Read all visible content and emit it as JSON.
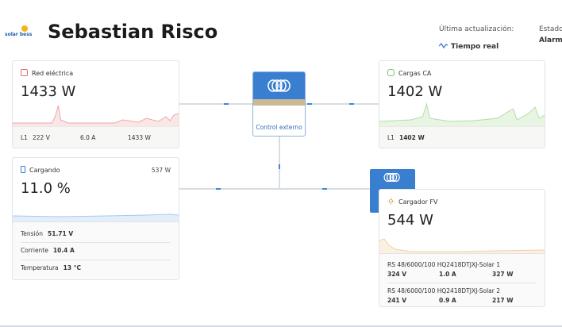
{
  "header": {
    "logo_text": "solar bess",
    "title": "Sebastian Risco",
    "update_label": "Última actualización:",
    "update_value": "Tiempo real",
    "status_label": "Estado:",
    "status_value": "Alarma"
  },
  "grid": {
    "title": "Red eléctrica",
    "power": "1433 W",
    "phase": "L1",
    "voltage": "222 V",
    "current": "6.0 A",
    "phase_power": "1433 W"
  },
  "battery": {
    "title": "Cargando",
    "power": "537 W",
    "soc": "11.0 %",
    "rows": [
      {
        "label": "Tensión",
        "value": "51.71 V"
      },
      {
        "label": "Corriente",
        "value": "10.4 A"
      },
      {
        "label": "Temperatura",
        "value": "13 °C"
      }
    ]
  },
  "control": {
    "label": "Control externo"
  },
  "ac_loads": {
    "title": "Cargas CA",
    "power": "1402 W",
    "phase": "L1",
    "phase_power": "1402 W"
  },
  "pv": {
    "title": "Cargador FV",
    "power": "544 W",
    "chargers": [
      {
        "name": "RS 48/6000/100 HQ2418DTJXJ-Solar 1",
        "voltage": "324 V",
        "current": "1.0 A",
        "power": "327 W"
      },
      {
        "name": "RS 48/6000/100 HQ2418DTJXJ-Solar 2",
        "voltage": "241 V",
        "current": "0.9 A",
        "power": "217 W"
      }
    ]
  },
  "colors": {
    "grid": "#e46a6a",
    "battery": "#5aa0e0",
    "ac_loads": "#7cc26e",
    "pv": "#e8b070",
    "accent": "#3a7ed0"
  }
}
